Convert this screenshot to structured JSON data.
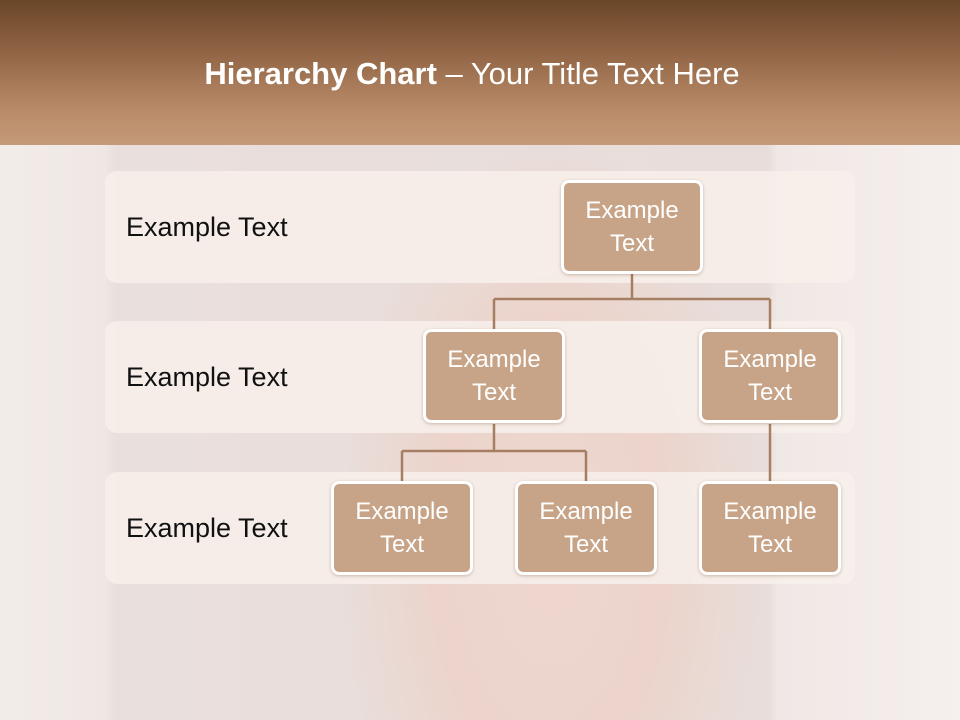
{
  "title": {
    "bold": "Hierarchy Chart",
    "rest": " – Your Title Text Here"
  },
  "rows": [
    {
      "label": "Example Text"
    },
    {
      "label": "Example Text"
    },
    {
      "label": "Example Text"
    }
  ],
  "nodes": {
    "root": {
      "line1": "Example",
      "line2": "Text"
    },
    "mid_left": {
      "line1": "Example",
      "line2": "Text"
    },
    "mid_right": {
      "line1": "Example",
      "line2": "Text"
    },
    "leaf_1": {
      "line1": "Example",
      "line2": "Text"
    },
    "leaf_2": {
      "line1": "Example",
      "line2": "Text"
    },
    "leaf_3": {
      "line1": "Example",
      "line2": "Text"
    }
  },
  "colors": {
    "node_fill": "#c7a487",
    "connector": "#a67f63",
    "header_dark": "#6a4629",
    "header_light": "#c49a78"
  }
}
